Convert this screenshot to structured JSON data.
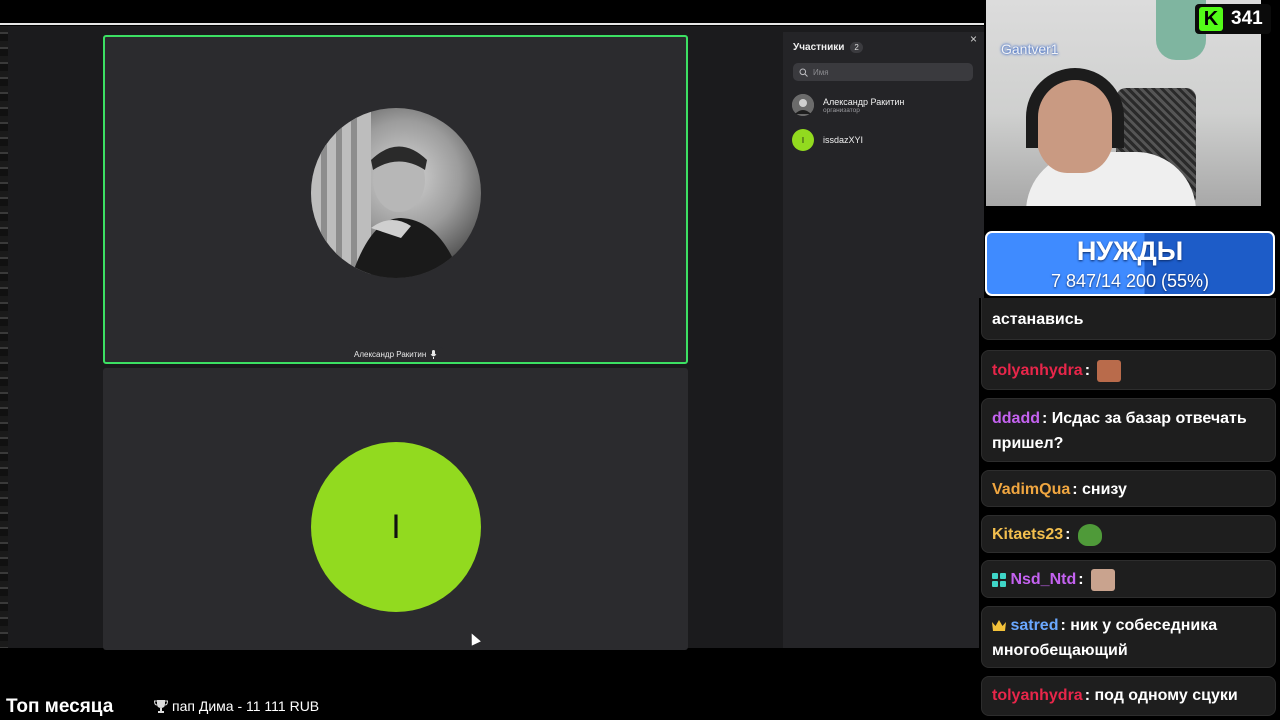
{
  "meeting": {
    "speaker_name": "Александр Ракитин",
    "second_tile_letter": "I"
  },
  "participants_panel": {
    "title": "Участники",
    "count": "2",
    "close": "×",
    "search_placeholder": "Имя",
    "items": [
      {
        "name": "Александр Ракитин",
        "role": "организатор",
        "avatar_color": "#7a7a7a",
        "letter": ""
      },
      {
        "name": "issdazXYI",
        "role": "",
        "avatar_color": "#92da1f",
        "letter": "I"
      }
    ]
  },
  "stream": {
    "cam_name": "Gantver1",
    "kick_count": "341",
    "needs_title": "НУЖДЫ",
    "needs_progress": "7 847/14 200 (55%)",
    "needs_fraction": 0.55
  },
  "chat": {
    "messages": [
      {
        "user": "",
        "text": "астанавись",
        "color": "#ffffff"
      },
      {
        "user": "tolyanhydra",
        "text": "",
        "color": "#e8264a",
        "emote": "#b96b4b"
      },
      {
        "user": "ddadd",
        "text": "Исдас за базар отвечать пришел?",
        "color": "#c462f0"
      },
      {
        "user": "VadimQua",
        "text": "снизу",
        "color": "#f0a640"
      },
      {
        "user": "Kitaets23",
        "text": "",
        "color": "#f3bf4e",
        "emote": "#4f9a39"
      },
      {
        "user": "Nsd_Ntd",
        "text": "",
        "color": "#c462f0",
        "emote": "#c9a38e"
      },
      {
        "user": "satred",
        "text": "ник у собеседника многобещающий",
        "color": "#6aa8ff"
      },
      {
        "user": "tolyanhydra",
        "text": "под одному сцуки",
        "color": "#e8264a"
      }
    ]
  },
  "ticker": {
    "title": "Топ месяца",
    "item": "пап Дима - 11 111 RUB"
  }
}
